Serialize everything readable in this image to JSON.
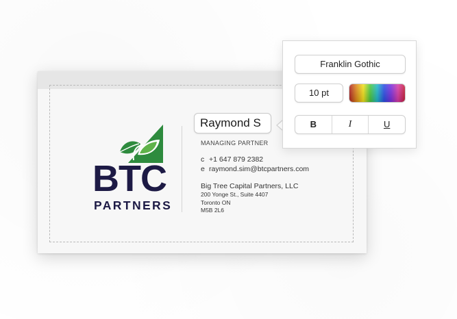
{
  "signature": {
    "name": "Raymond S",
    "title": "MANAGING PARTNER",
    "contacts": [
      {
        "prefix": "c",
        "value": "+1 647 879 2382"
      },
      {
        "prefix": "e",
        "value": "raymond.sim@btcpartners.com"
      }
    ],
    "company": "Big Tree Capital Partners, LLC",
    "address": [
      "200 Yonge St., Suite 4407",
      "Toronto ON",
      "M5B 2L6"
    ]
  },
  "logo": {
    "wordmark": "BTC",
    "tagline": "PARTNERS",
    "colors": {
      "navy": "#1d1a45",
      "green": "#2e8b3e",
      "light_green": "#5fb34a"
    }
  },
  "format_panel": {
    "font_family": "Franklin Gothic",
    "font_size": "10 pt",
    "color_swatch": "rainbow-gradient",
    "bold_label": "B",
    "italic_label": "I",
    "underline_label": "U"
  }
}
